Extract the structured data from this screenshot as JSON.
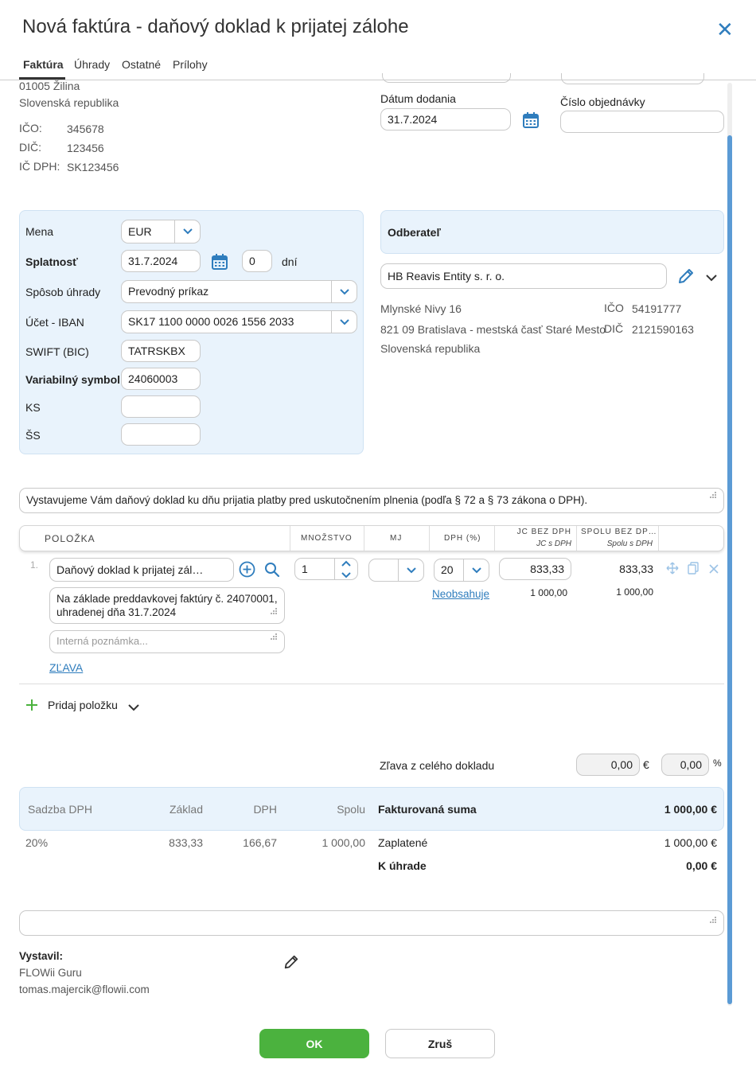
{
  "dialog": {
    "title": "Nová faktúra - daňový doklad k prijatej zálohe"
  },
  "tabs": [
    {
      "label": "Faktúra"
    },
    {
      "label": "Úhrady"
    },
    {
      "label": "Ostatné"
    },
    {
      "label": "Prílohy"
    }
  ],
  "supplier": {
    "city": "01005 Žilina",
    "country": "Slovenská republika",
    "ico_label": "IČO:",
    "ico": "345678",
    "dic_label": "DIČ:",
    "dic": "123456",
    "icdph_label": "IČ DPH:",
    "icdph": "SK123456"
  },
  "delivery": {
    "date_label": "Dátum dodania",
    "date": "31.7.2024",
    "order_label": "Číslo objednávky",
    "order": ""
  },
  "payment": {
    "currency_label": "Mena",
    "currency": "EUR",
    "due_label": "Splatnosť",
    "due": "31.7.2024",
    "days": "0",
    "days_unit": "dní",
    "method_label": "Spôsob úhrady",
    "method": "Prevodný príkaz",
    "iban_label": "Účet - IBAN",
    "iban": "SK17 1100 0000 0026 1556 2033",
    "swift_label": "SWIFT (BIC)",
    "swift": "TATRSKBX",
    "vs_label": "Variabilný symbol",
    "vs": "24060003",
    "ks_label": "KS",
    "ks": "",
    "ss_label": "ŠS",
    "ss": ""
  },
  "customer": {
    "heading": "Odberateľ",
    "name": "HB Reavis Entity s. r. o.",
    "street": "Mlynské Nivy 16",
    "city": "821 09 Bratislava - mestská časť Staré Mesto",
    "country": "Slovenská republika",
    "ico_label": "IČO",
    "ico": "54191777",
    "dic_label": "DIČ",
    "dic": "2121590163"
  },
  "intro_text": "Vystavujeme Vám daňový doklad ku dňu prijatia platby pred uskutočnením plnenia (podľa § 72 a § 73 zákona o DPH).",
  "items_table": {
    "col_item": "POLOŽKA",
    "col_qty": "MNOŽSTVO",
    "col_unit": "MJ",
    "col_vat": "DPH (%)",
    "col_unit_price": "JC BEZ DPH",
    "col_unit_price_sub": "JC s DPH",
    "col_total": "SPOLU BEZ DP…",
    "col_total_sub": "Spolu s DPH",
    "rows": [
      {
        "num": "1.",
        "name": "Daňový doklad k prijatej zál…",
        "description": "Na základe preddavkovej faktúry č. 24070001, uhradenej dňa 31.7.2024",
        "note_placeholder": "Interná poznámka...",
        "discount_link": "ZĽAVA",
        "qty": "1",
        "unit": "",
        "vat": "20",
        "vat_note": "Neobsahuje",
        "unit_price": "833,33",
        "unit_price_vat": "1 000,00",
        "total": "833,33",
        "total_vat": "1 000,00"
      }
    ],
    "add_item": "Pridaj položku"
  },
  "discount": {
    "label": "Zľava z celého dokladu",
    "amount": "0,00",
    "currency": "€",
    "percent": "0,00",
    "percent_sign": "%"
  },
  "summary": {
    "col_rate": "Sadzba DPH",
    "col_base": "Základ",
    "col_vat": "DPH",
    "col_total": "Spolu",
    "rows": [
      {
        "rate": "20%",
        "base": "833,33",
        "vat": "166,67",
        "total": "1 000,00"
      }
    ],
    "invoiced_label": "Fakturovaná suma",
    "invoiced": "1 000,00 €",
    "paid_label": "Zaplatené",
    "paid": "1 000,00 €",
    "due_label": "K úhrade",
    "due": "0,00 €"
  },
  "issuer": {
    "label": "Vystavil:",
    "name": "FLOWii Guru",
    "email": "tomas.majercik@flowii.com"
  },
  "buttons": {
    "ok": "OK",
    "cancel": "Zruš"
  },
  "colors": {
    "accent": "#2f7dbd",
    "ok": "#4bb23e",
    "panel": "#e9f3fc"
  }
}
